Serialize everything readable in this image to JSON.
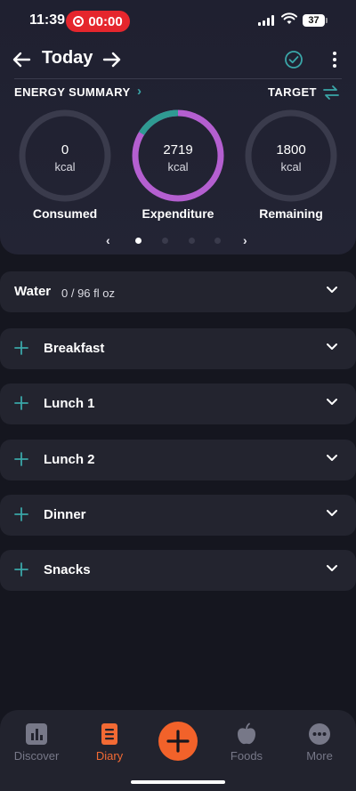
{
  "status_bar": {
    "time": "11:39",
    "recording_time": "00:00",
    "battery": "37"
  },
  "header": {
    "title": "Today",
    "back_icon": "arrow-left-icon",
    "forward_icon": "arrow-right-icon",
    "check_icon": "check-circle-icon",
    "menu_icon": "more-vertical-icon"
  },
  "energy_summary": {
    "title": "ENERGY SUMMARY",
    "target_label": "TARGET",
    "rings": [
      {
        "value": "0",
        "unit": "kcal",
        "label": "Consumed",
        "progress": 0
      },
      {
        "value": "2719",
        "unit": "kcal",
        "label": "Expenditure",
        "progress": 1
      },
      {
        "value": "1800",
        "unit": "kcal",
        "label": "Remaining",
        "progress": 0
      }
    ],
    "pager": {
      "active_index": 0,
      "count": 4
    }
  },
  "meals": {
    "water": {
      "label": "Water",
      "value": "0 / 96 fl oz"
    },
    "items": [
      {
        "label": "Breakfast"
      },
      {
        "label": "Lunch 1"
      },
      {
        "label": "Lunch 2"
      },
      {
        "label": "Dinner"
      },
      {
        "label": "Snacks"
      }
    ]
  },
  "bottom_nav": {
    "tabs": [
      {
        "label": "Discover",
        "icon": "bar-chart-icon"
      },
      {
        "label": "Diary",
        "icon": "diary-icon"
      },
      {
        "label": "Foods",
        "icon": "apple-icon"
      },
      {
        "label": "More",
        "icon": "more-horizontal-icon"
      }
    ],
    "active_tab": "Diary",
    "add_icon": "plus-icon"
  },
  "colors": {
    "accent_orange": "#f2622a",
    "accent_teal": "#3aa6a8",
    "ring_purple": "#b45fd0",
    "ring_track": "#3a3b4c",
    "card_bg": "#23242f",
    "page_bg": "#15161f"
  }
}
